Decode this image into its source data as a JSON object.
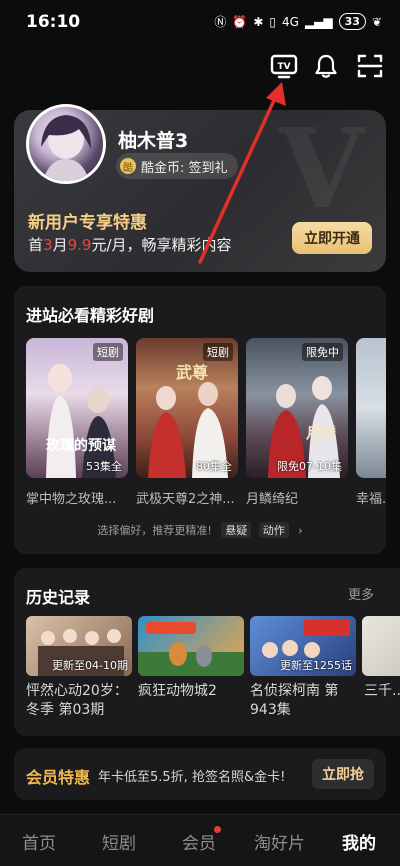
{
  "status": {
    "time": "16:10",
    "battery": "33",
    "network": "4G"
  },
  "header": {
    "icons": [
      "tv-icon",
      "bell-icon",
      "scan-icon"
    ]
  },
  "user": {
    "name": "柚木普3",
    "coin_label": "酷金币: 签到礼",
    "promo_title": "新用户专享特惠",
    "promo_prefix": "首",
    "promo_month": "3",
    "promo_mid": "月",
    "promo_price": "9.9",
    "promo_suffix": "元/月，畅享精彩内容",
    "open_button": "立即开通"
  },
  "picks": {
    "title": "进站必看精彩好剧",
    "items": [
      {
        "title": "掌中物之玫瑰...",
        "tag": "短剧",
        "eps": "53集全"
      },
      {
        "title": "武极天尊2之神...",
        "tag": "短剧",
        "eps": "80集全"
      },
      {
        "title": "月鳞绮纪",
        "tag": "限免中",
        "eps": "限免07-10集"
      },
      {
        "title": "幸福...",
        "tag": "",
        "eps": ""
      }
    ],
    "pref_hint": "选择偏好，推荐更精准!",
    "pref_genre_1": "悬疑",
    "pref_genre_2": "动作"
  },
  "history": {
    "title": "历史记录",
    "more": "更多",
    "items": [
      {
        "title": "怦然心动20岁：冬季 第03期",
        "update": "更新至04-10期"
      },
      {
        "title": "疯狂动物城2",
        "update": ""
      },
      {
        "title": "名侦探柯南 第943集",
        "update": "更新至1255话"
      },
      {
        "title": "三千...",
        "update": ""
      }
    ]
  },
  "vip": {
    "title": "会员特惠",
    "text": "年卡低至5.5折, 抢签名照&金卡!",
    "button": "立即抢"
  },
  "nav": {
    "items": [
      "首页",
      "短剧",
      "会员",
      "淘好片",
      "我的"
    ],
    "active": "我的"
  },
  "colors": {
    "accent_gold": "#f4cf86",
    "price_red": "#e44a3d",
    "annotation_arrow": "#e0302a"
  }
}
